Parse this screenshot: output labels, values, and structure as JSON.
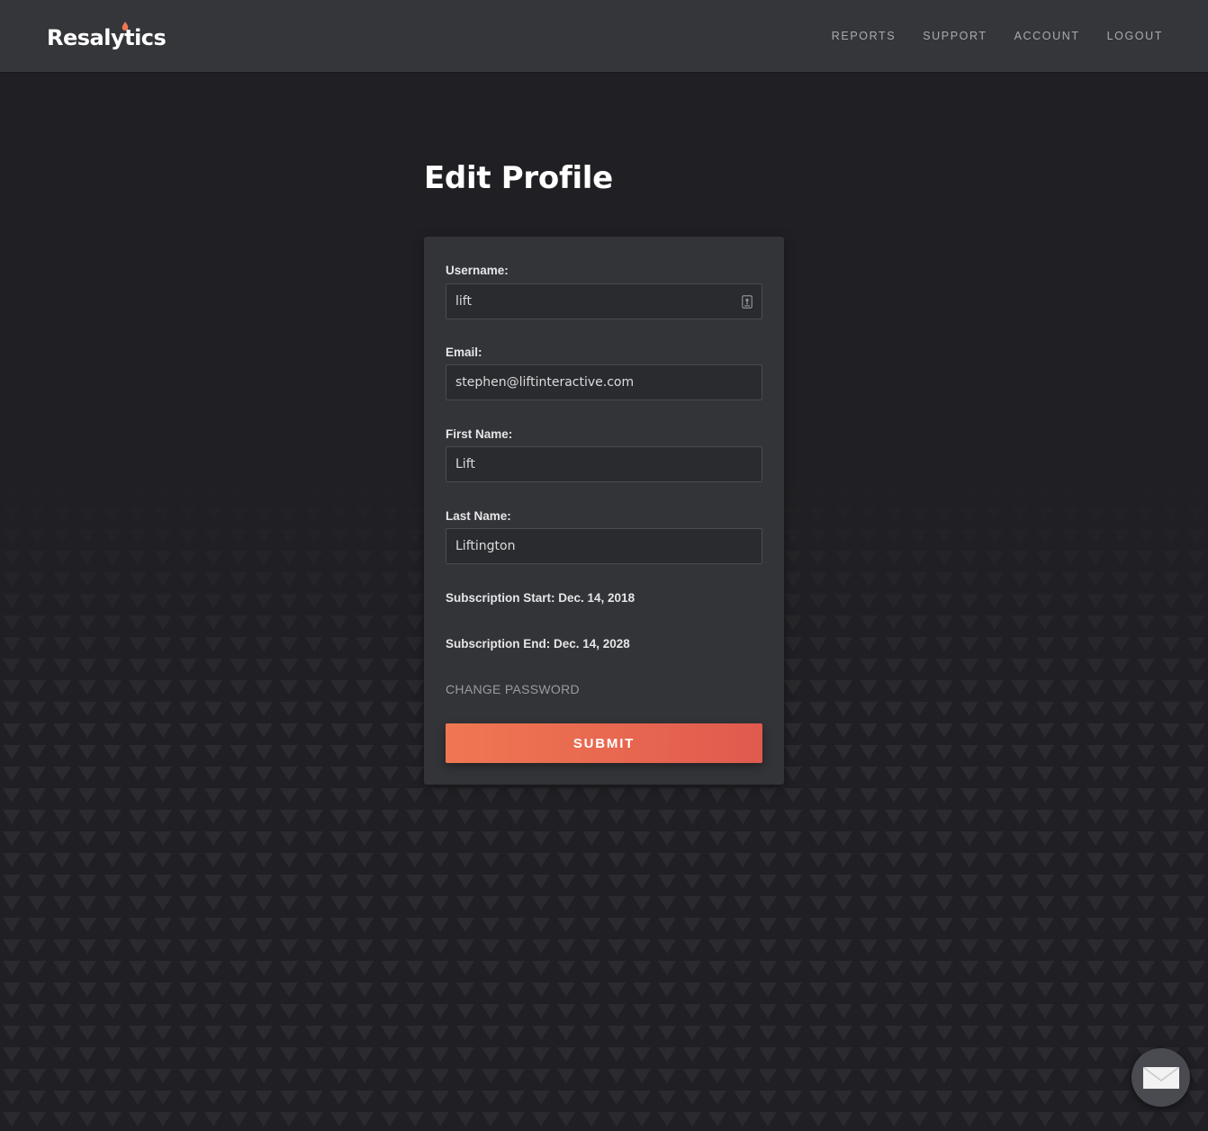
{
  "header": {
    "logo_text": "Resalytics",
    "nav": [
      "REPORTS",
      "SUPPORT",
      "ACCOUNT",
      "LOGOUT"
    ]
  },
  "page": {
    "title": "Edit Profile"
  },
  "form": {
    "username_label": "Username:",
    "username_value": "lift",
    "email_label": "Email:",
    "email_value": "stephen@liftinteractive.com",
    "first_name_label": "First Name:",
    "first_name_value": "Lift",
    "last_name_label": "Last Name:",
    "last_name_value": "Liftington",
    "subscription_start": "Subscription Start: Dec. 14, 2018",
    "subscription_end": "Subscription End: Dec. 14, 2028",
    "change_password": "CHANGE PASSWORD",
    "submit_label": "SUBMIT"
  },
  "icons": {
    "username_field": "password-manager-key-icon",
    "chat": "envelope-icon",
    "logo_accent": "flame-icon"
  },
  "colors": {
    "background": "#202024",
    "topbar": "#35363a",
    "card": "#333438",
    "accent_start": "#f07752",
    "accent_end": "#e05a4e"
  }
}
